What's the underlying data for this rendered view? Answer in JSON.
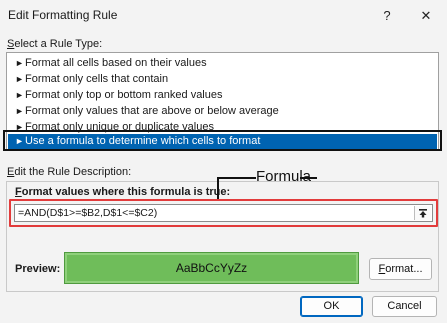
{
  "window": {
    "title": "Edit Formatting Rule",
    "help_glyph": "?",
    "close_glyph": "✕"
  },
  "rule_type": {
    "label_prefix": "S",
    "label_rest": "elect a Rule Type:",
    "items": [
      {
        "label": "Format all cells based on their values"
      },
      {
        "label": "Format only cells that contain"
      },
      {
        "label": "Format only top or bottom ranked values"
      },
      {
        "label": "Format only values that are above or below average"
      },
      {
        "label": "Format only unique or duplicate values"
      },
      {
        "label": "Use a formula to determine which cells to format"
      }
    ],
    "selected_index": 5
  },
  "description": {
    "label_prefix": "E",
    "label_rest": "dit the Rule Description:",
    "formula_label_prefix": "F",
    "formula_label_rest": "ormat values where this formula is true:",
    "formula_value": "=AND(D$1>=$B2,D$1<=$C2)",
    "callout": "Formula"
  },
  "preview": {
    "label": "Preview:",
    "sample_text": "AaBbCcYyZz",
    "sample_fill": "#6fbd5a",
    "format_button_prefix": "F",
    "format_button_rest": "ormat..."
  },
  "footer": {
    "ok_label": "OK",
    "cancel_label": "Cancel"
  },
  "colors": {
    "selected_row": "#0063b1",
    "highlight_red": "#e23b3b",
    "outline_black": "#111111"
  },
  "icons": {
    "rule_bullet": "arrow-right-icon",
    "collapse": "collapse-dialog-icon"
  }
}
